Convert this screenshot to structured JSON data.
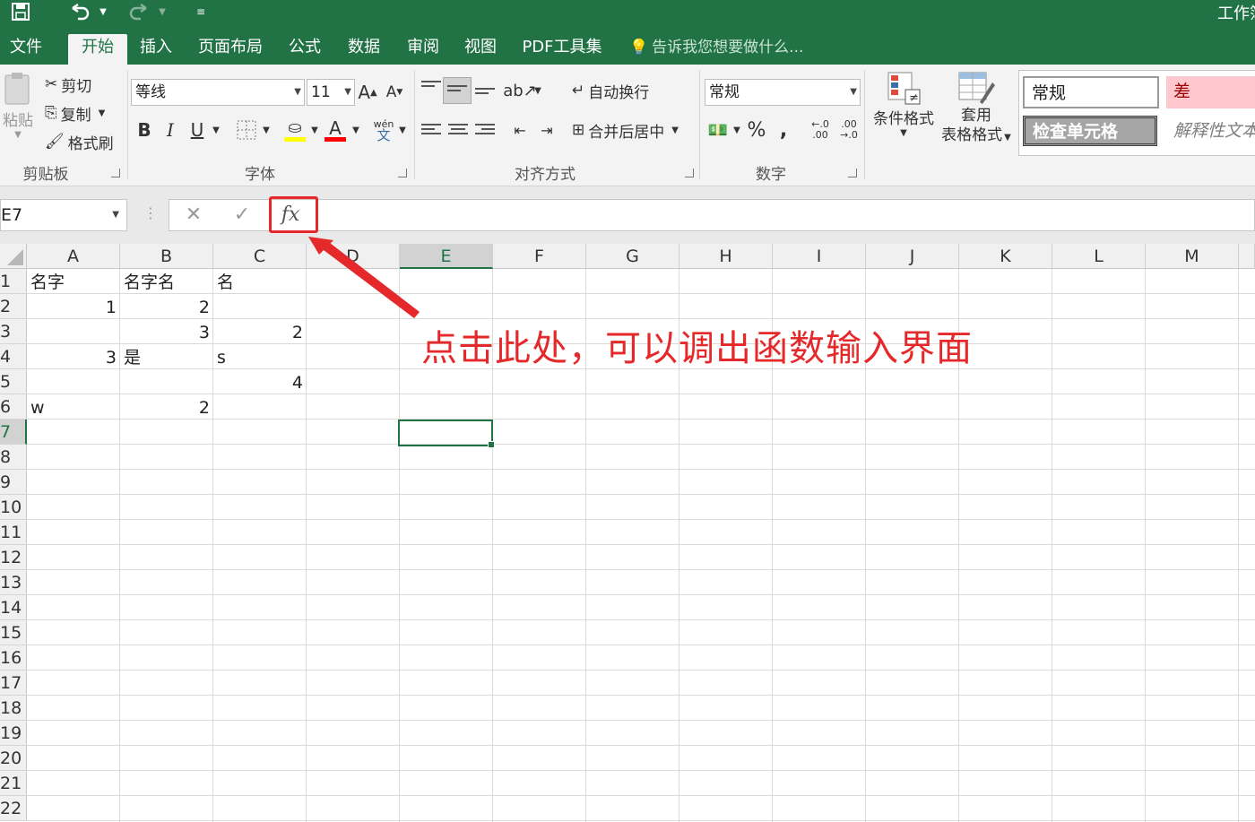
{
  "window": {
    "title": "工作簿"
  },
  "quick_access": {
    "save_icon": "save-icon",
    "undo_icon": "undo-icon",
    "redo_icon": "redo-icon",
    "customize_icon": "customize-qat-icon"
  },
  "tabs": [
    {
      "label": "文件"
    },
    {
      "label": "开始",
      "active": true
    },
    {
      "label": "插入"
    },
    {
      "label": "页面布局"
    },
    {
      "label": "公式"
    },
    {
      "label": "数据"
    },
    {
      "label": "审阅"
    },
    {
      "label": "视图"
    },
    {
      "label": "PDF工具集"
    }
  ],
  "tell_me": {
    "placeholder": "告诉我您想要做什么..."
  },
  "ribbon": {
    "clipboard": {
      "label": "剪贴板",
      "paste": "粘贴",
      "cut": "剪切",
      "copy": "复制",
      "format_painter": "格式刷"
    },
    "font": {
      "label": "字体",
      "font_name": "等线",
      "font_size": "11",
      "bold": "B",
      "italic": "I",
      "underline": "U",
      "phonetic": "wén"
    },
    "alignment": {
      "label": "对齐方式",
      "wrap": "自动换行",
      "merge": "合并后居中"
    },
    "number": {
      "label": "数字",
      "format": "常规",
      "percent": "%",
      "comma": ","
    },
    "styles": {
      "conditional": "条件格式",
      "table_format_1": "套用",
      "table_format_2": "表格格式",
      "normal": "常规",
      "bad": "差",
      "check_cell": "检查单元格",
      "explanatory": "解释性文本"
    }
  },
  "formula_bar": {
    "name_box": "E7",
    "cancel": "✕",
    "enter": "✓",
    "fx": "fx",
    "content": ""
  },
  "columns": [
    "A",
    "B",
    "C",
    "D",
    "E",
    "F",
    "G",
    "H",
    "I",
    "J",
    "K",
    "L",
    "M"
  ],
  "selected_column": "E",
  "rows": [
    "1",
    "2",
    "3",
    "4",
    "5",
    "6",
    "7",
    "8",
    "9",
    "10",
    "11",
    "12",
    "13",
    "14",
    "15",
    "16",
    "17",
    "18",
    "19",
    "20",
    "21",
    "22"
  ],
  "selected_row": "7",
  "cells": {
    "A1": "名字",
    "B1": "名字名",
    "C1": "名",
    "A2": "1",
    "B2": "2",
    "B3": "3",
    "C3": "2",
    "A4": "3",
    "B4": "是",
    "C4": "s",
    "C5": "4",
    "A6": "w",
    "B6": "2"
  },
  "annotation": {
    "text": "点击此处，可以调出函数输入界面",
    "color": "#e5282a"
  },
  "colors": {
    "excel_green": "#217346",
    "annotation_red": "#e5282a"
  }
}
